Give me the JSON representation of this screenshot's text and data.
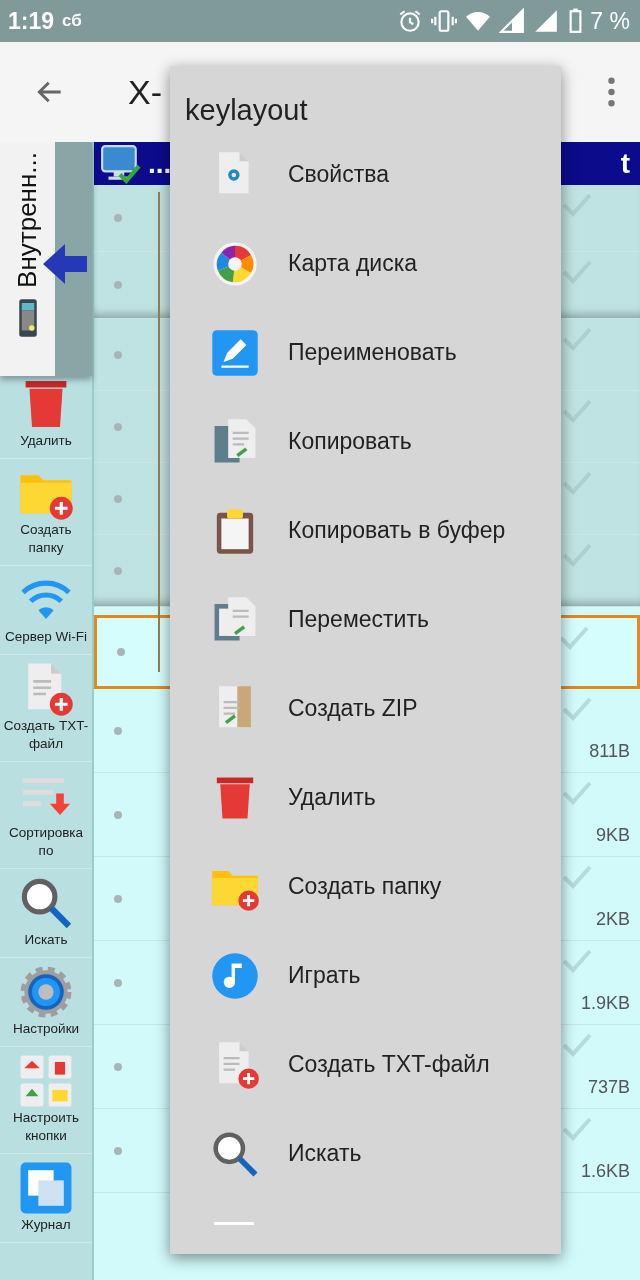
{
  "status_bar": {
    "time": "1:19",
    "day": "сб",
    "battery": "7 %"
  },
  "toolbar": {
    "title": "X-"
  },
  "location_panel": {
    "label": "Внутренн..."
  },
  "sidebar": {
    "items": [
      {
        "kind": "delete",
        "label": "Удалить"
      },
      {
        "kind": "new-folder",
        "label": "Создать папку"
      },
      {
        "kind": "wifi",
        "label": "Сервер Wi-Fi"
      },
      {
        "kind": "new-txt",
        "label": "Создать TXT-файл"
      },
      {
        "kind": "sort",
        "label": "Сортировка по"
      },
      {
        "kind": "search",
        "label": "Искать"
      },
      {
        "kind": "settings",
        "label": "Настройки"
      },
      {
        "kind": "buttons",
        "label": "Настроить кнопки"
      },
      {
        "kind": "log",
        "label": "Журнал"
      }
    ]
  },
  "file_list": {
    "header": {
      "path": "...",
      "column_2": "t"
    },
    "sections": [
      {
        "kind": "group",
        "rows": [
          {
            "selected": false
          },
          {
            "selected": false
          }
        ]
      },
      {
        "kind": "group",
        "rows": [
          {
            "selected": false
          },
          {
            "selected": false
          },
          {
            "selected": false
          },
          {
            "selected": false
          }
        ]
      },
      {
        "kind": "plain",
        "rows": [
          {
            "selected": true
          },
          {
            "selected": false,
            "size": "811B"
          },
          {
            "selected": false,
            "size": "9KB"
          },
          {
            "selected": false,
            "size": "2KB"
          },
          {
            "selected": false,
            "size": "1.9KB"
          },
          {
            "selected": false,
            "size": "737B"
          },
          {
            "selected": false,
            "size": "1.6KB"
          }
        ]
      }
    ]
  },
  "context_menu": {
    "title": "keylayout",
    "items": [
      {
        "kind": "properties",
        "label": "Свойства"
      },
      {
        "kind": "disk-map",
        "label": "Карта диска"
      },
      {
        "kind": "rename",
        "label": "Переименовать"
      },
      {
        "kind": "copy",
        "label": "Копировать"
      },
      {
        "kind": "clipboard",
        "label": "Копировать в буфер"
      },
      {
        "kind": "move",
        "label": "Переместить"
      },
      {
        "kind": "zip",
        "label": "Создать ZIP"
      },
      {
        "kind": "delete",
        "label": "Удалить"
      },
      {
        "kind": "new-folder",
        "label": "Создать папку"
      },
      {
        "kind": "play",
        "label": "Играть"
      },
      {
        "kind": "new-txt",
        "label": "Создать TXT-файл"
      },
      {
        "kind": "search",
        "label": "Искать"
      }
    ]
  }
}
